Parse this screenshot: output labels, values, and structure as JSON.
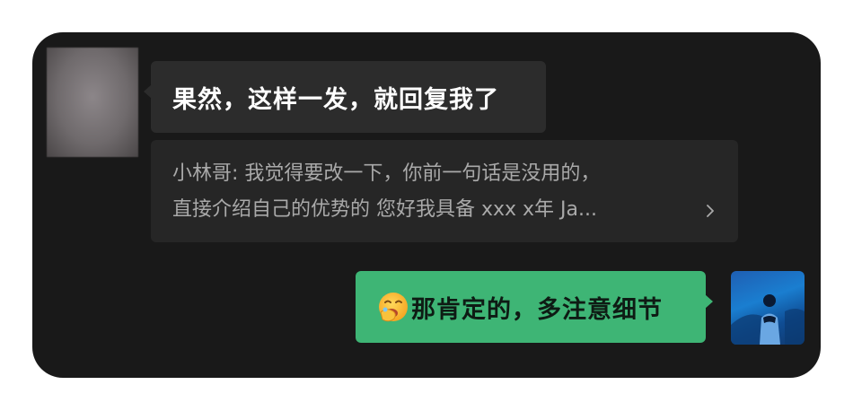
{
  "messages": [
    {
      "sender": "other",
      "text": "果然，这样一发，就回复我了"
    },
    {
      "sender": "other",
      "type": "quote",
      "quote_line1": "小林哥: 我觉得要改一下，你前一句话是没用的，",
      "quote_line2": "直接介绍自己的优势的  您好我具备 xxx x年 Ja..."
    },
    {
      "sender": "me",
      "emoji": "face-with-hand-over-mouth-emoji",
      "text": "那肯定的，多注意细节"
    }
  ],
  "colors": {
    "window_bg": "#191919",
    "incoming_bubble": "#2c2c2c",
    "quote_bg": "#262626",
    "outgoing_bubble": "#3eb575"
  }
}
